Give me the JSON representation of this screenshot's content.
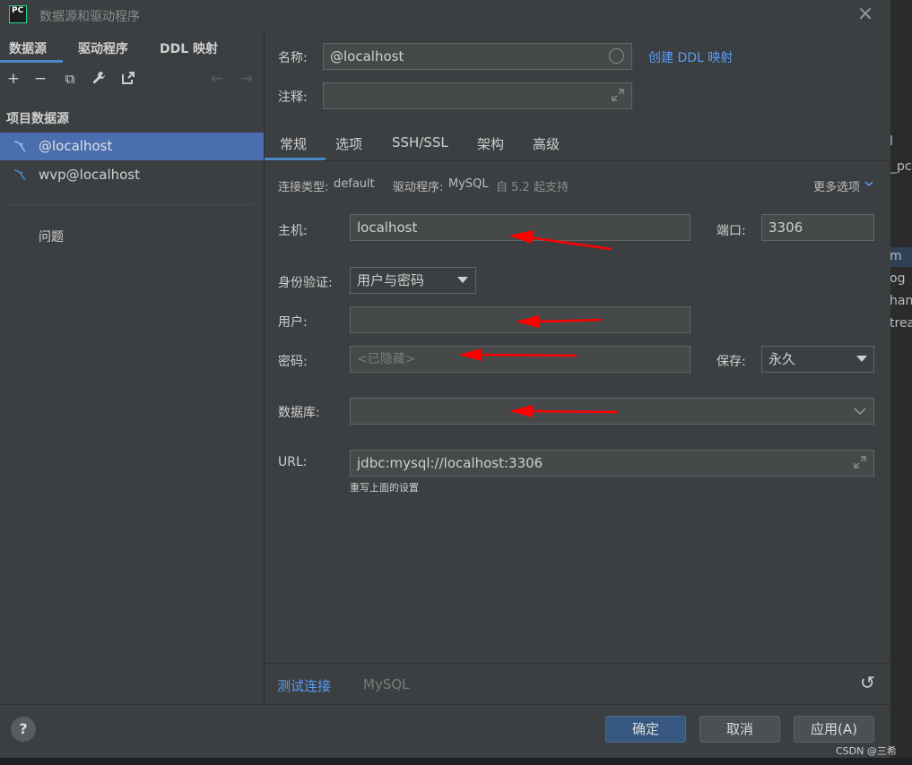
{
  "window": {
    "title": "数据源和驱动程序",
    "app_icon": "PC"
  },
  "background_text": [
    "l",
    "_pc",
    "m",
    "og",
    "han",
    "trea"
  ],
  "left": {
    "tabs": [
      "数据源",
      "驱动程序",
      "DDL 映射"
    ],
    "toolbar": {
      "add": "+",
      "remove": "−",
      "copy": "⧉",
      "wrench": "🔧",
      "export": "⇱",
      "back": "←",
      "forward": "→"
    },
    "section_title": "项目数据源",
    "datasources": [
      "@localhost",
      "wvp@localhost"
    ],
    "problems": "问题"
  },
  "form": {
    "name_label": "名称:",
    "name_value": "@localhost",
    "create_ddl_link": "创建 DDL 映射",
    "comment_label": "注释:",
    "comment_value": "",
    "tabs": [
      "常规",
      "选项",
      "SSH/SSL",
      "架构",
      "高级"
    ],
    "conn_type_label": "连接类型:",
    "conn_type_value": "default",
    "driver_label": "驱动程序:",
    "driver_value": "MySQL",
    "driver_support": "自 5.2 起支持",
    "more_options": "更多选项",
    "host_label": "主机:",
    "host_value": "localhost",
    "port_label": "端口:",
    "port_value": "3306",
    "auth_label": "身份验证:",
    "auth_value": "用户与密码",
    "user_label": "用户:",
    "user_value": "",
    "password_label": "密码:",
    "password_placeholder": "<已隐藏>",
    "save_label": "保存:",
    "save_value": "永久",
    "database_label": "数据库:",
    "database_value": "",
    "url_label": "URL:",
    "url_value": "jdbc:mysql://localhost:3306",
    "url_hint": "重写上面的设置"
  },
  "bottom": {
    "test_connection": "测试连接",
    "db_type": "MySQL",
    "reset_icon": "↺"
  },
  "footer": {
    "help": "?",
    "ok": "确定",
    "cancel": "取消",
    "apply": "应用(A)"
  },
  "watermark": "CSDN @三希",
  "colors": {
    "accent": "#4a88c7",
    "link": "#589df6",
    "selection": "#4b6eaf",
    "annotation_arrow": "#ff0000"
  }
}
